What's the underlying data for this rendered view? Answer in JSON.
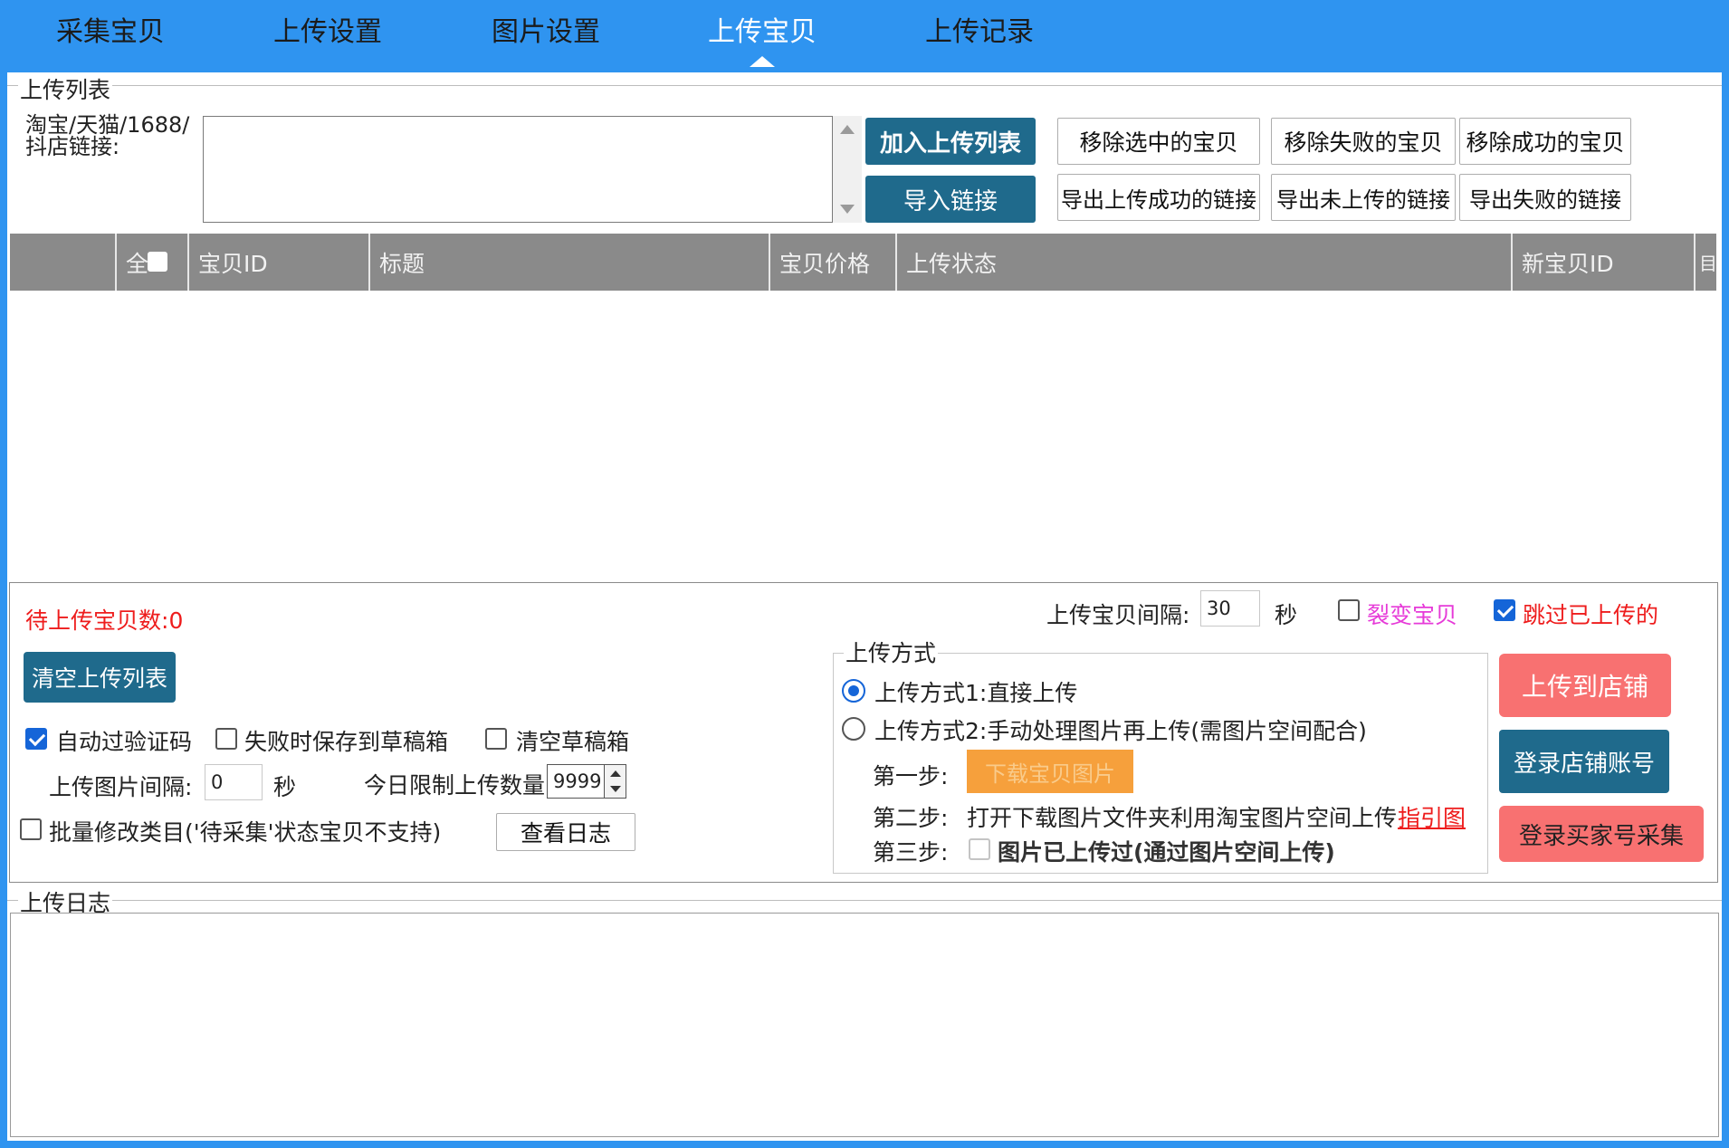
{
  "tabs": [
    {
      "label": "采集宝贝",
      "active": false
    },
    {
      "label": "上传设置",
      "active": false
    },
    {
      "label": "图片设置",
      "active": false
    },
    {
      "label": "上传宝贝",
      "active": true
    },
    {
      "label": "上传记录",
      "active": false
    }
  ],
  "upload_list": {
    "legend": "上传列表",
    "link_label": "淘宝/天猫/1688/\n抖店链接:",
    "link_value": "",
    "add_button": "加入上传列表",
    "import_button": "导入链接",
    "remove_selected": "移除选中的宝贝",
    "remove_failed": "移除失败的宝贝",
    "remove_success": "移除成功的宝贝",
    "export_success": "导出上传成功的链接",
    "export_not_uploaded": "导出未上传的链接",
    "export_failed": "导出失败的链接"
  },
  "table": {
    "select_all": "全",
    "columns": [
      "宝贝ID",
      "标题",
      "宝贝价格",
      "上传状态",
      "新宝贝ID",
      "目"
    ],
    "rows": []
  },
  "controls": {
    "pending_count_label": "待上传宝贝数:",
    "pending_count": "0",
    "interval_label": "上传宝贝间隔:",
    "interval_value": "30",
    "interval_unit": "秒",
    "fission_label": "裂变宝贝",
    "fission_checked": false,
    "skip_uploaded_label": "跳过已上传的",
    "skip_uploaded_checked": true,
    "clear_list_button": "清空上传列表",
    "auto_captcha_label": "自动过验证码",
    "auto_captcha_checked": true,
    "save_draft_label": "失败时保存到草稿箱",
    "save_draft_checked": false,
    "clear_draft_label": "清空草稿箱",
    "clear_draft_checked": false,
    "image_interval_label": "上传图片间隔:",
    "image_interval_value": "0",
    "image_interval_unit": "秒",
    "daily_limit_label": "今日限制上传数量",
    "daily_limit_value": "9999",
    "batch_category_label": "批量修改类目('待采集'状态宝贝不支持)",
    "batch_category_checked": false,
    "view_log_button": "查看日志"
  },
  "upload_mode": {
    "legend": "上传方式",
    "mode1_label": "上传方式1:直接上传",
    "mode1_selected": true,
    "mode2_label": "上传方式2:手动处理图片再上传(需图片空间配合)",
    "mode2_selected": false,
    "step1_label": "第一步:",
    "step1_button": "下载宝贝图片",
    "step2_label": "第二步:",
    "step2_text": "打开下载图片文件夹利用淘宝图片空间上传",
    "step2_link": "指引图",
    "step3_label": "第三步:",
    "step3_text": "图片已上传过(通过图片空间上传)",
    "step3_checked": false
  },
  "actions": {
    "upload_to_store": "上传到店铺",
    "login_store": "登录店铺账号",
    "login_buyer": "登录买家号采集"
  },
  "log": {
    "legend": "上传日志",
    "content": ""
  },
  "colors": {
    "accent_blue": "#2f94f0",
    "button_teal": "#1f6a8c",
    "button_red": "#f87171",
    "button_orange": "#f6a03c",
    "header_gray": "#8a8a8a",
    "warning_red": "#ee1c1c"
  }
}
